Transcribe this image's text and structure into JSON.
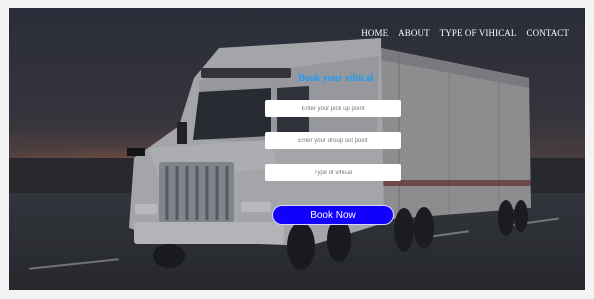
{
  "nav": {
    "items": [
      {
        "label": "HOME"
      },
      {
        "label": "ABOUT"
      },
      {
        "label": "TYPE OF VIHICAL"
      },
      {
        "label": "CONTACT"
      }
    ]
  },
  "booking": {
    "title": "Book your vihical",
    "pickup_placeholder": "Enter your pick up point",
    "dropout_placeholder": "Enter your droup out point",
    "type_placeholder": "Type of vihical",
    "button_label": "Book Now"
  },
  "colors": {
    "accent_title": "#1e9cf0",
    "button_bg": "#1200ff",
    "nav_text": "#ffffff"
  },
  "background": {
    "image_subject": "truck-photo"
  }
}
